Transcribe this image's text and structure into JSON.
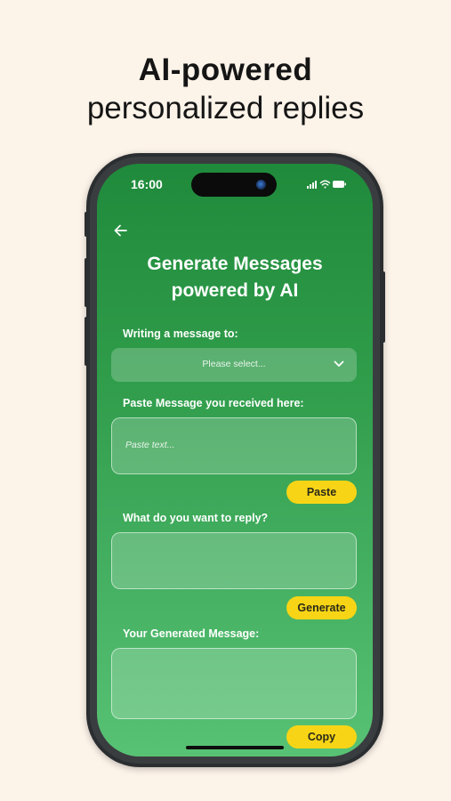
{
  "promo": {
    "headline_bold": "AI-powered",
    "headline_light": "personalized replies"
  },
  "status_bar": {
    "time": "16:00",
    "icons": [
      "signal-icon",
      "wifi-icon",
      "battery-icon"
    ]
  },
  "screen": {
    "back_icon": "arrow-left-icon",
    "title_line1": "Generate Messages",
    "title_line2": "powered by AI",
    "recipient": {
      "label": "Writing a message to:",
      "placeholder": "Please select...",
      "icon": "chevron-down-icon"
    },
    "received": {
      "label": "Paste Message you received here:",
      "placeholder": "Paste text...",
      "button": "Paste"
    },
    "reply_intent": {
      "label": "What do you want to reply?",
      "value": "",
      "button": "Generate"
    },
    "generated": {
      "label": "Your Generated Message:",
      "value": "",
      "button": "Copy"
    }
  },
  "colors": {
    "background": "#fcf3e9",
    "screen_top": "#1f8a3b",
    "screen_bottom": "#58c274",
    "accent_button": "#f7d516",
    "text_light": "#ffffff"
  }
}
